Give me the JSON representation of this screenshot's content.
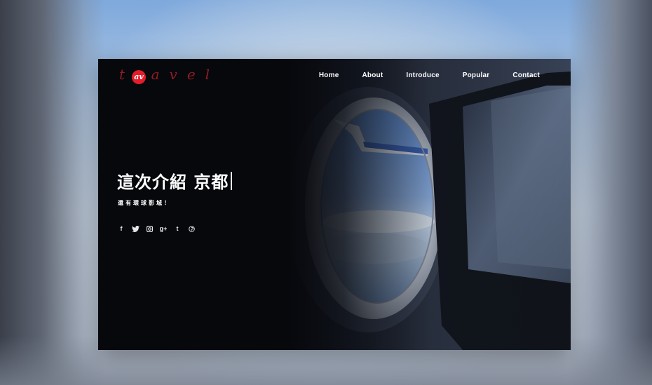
{
  "logo": {
    "text": "travel",
    "mark": "av"
  },
  "nav": {
    "items": [
      {
        "label": "Home"
      },
      {
        "label": "About"
      },
      {
        "label": "Introduce"
      },
      {
        "label": "Popular"
      },
      {
        "label": "Contact"
      }
    ]
  },
  "hero": {
    "headline": "這次介紹 京都",
    "subline": "還有環球影城！"
  },
  "social": {
    "items": [
      {
        "icon": "facebook-icon",
        "glyph": "f"
      },
      {
        "icon": "twitter-icon",
        "glyph": ""
      },
      {
        "icon": "instagram-icon",
        "glyph": ""
      },
      {
        "icon": "google-plus-icon",
        "glyph": "g+"
      },
      {
        "icon": "tumblr-icon",
        "glyph": "t"
      },
      {
        "icon": "pinterest-icon",
        "glyph": ""
      }
    ]
  },
  "colors": {
    "logo_red": "#e31d2b",
    "panel_bg": "#07080c",
    "text": "#ffffff"
  }
}
